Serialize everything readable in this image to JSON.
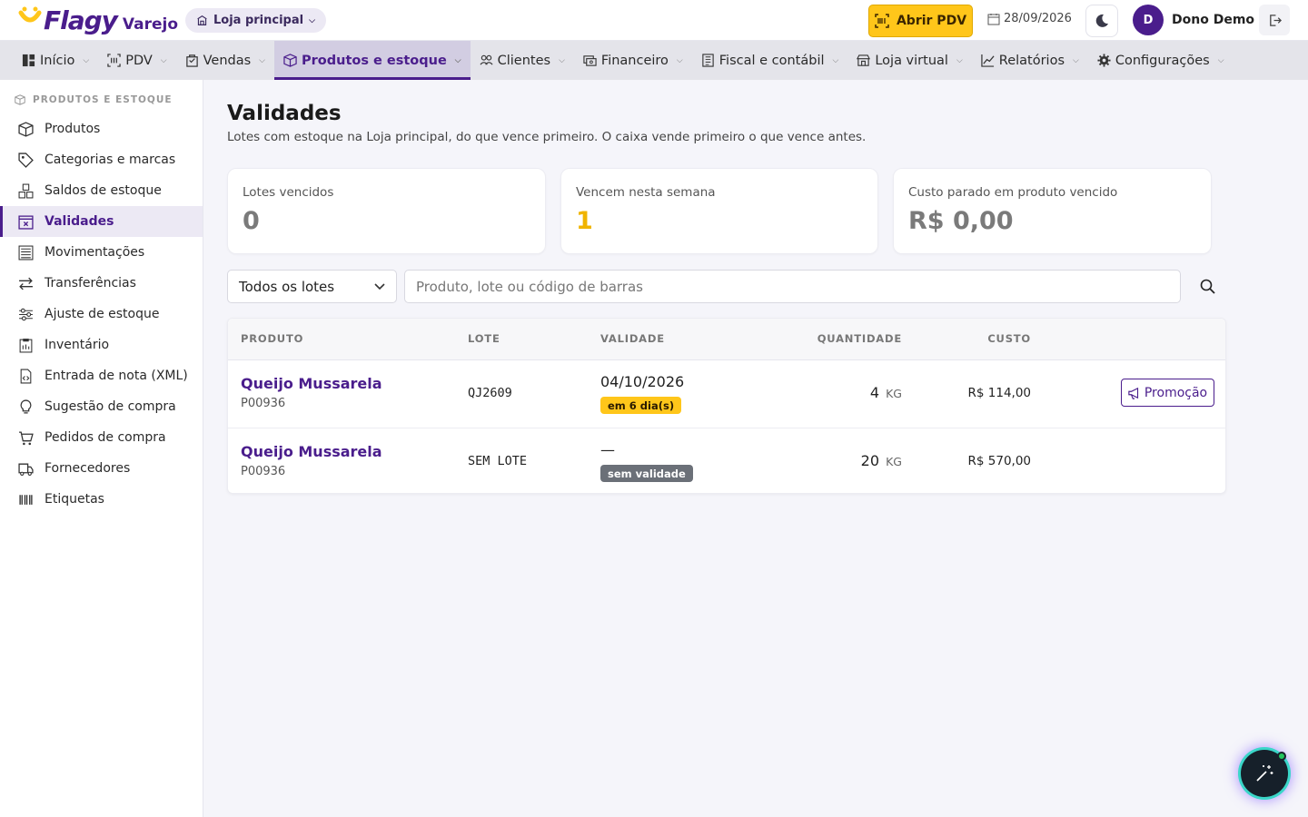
{
  "app": {
    "brand": "Flagy",
    "product": "Varejo",
    "store": "Loja principal",
    "open_pdv_label": "Abrir PDV",
    "date": "28/09/2026",
    "user_initial": "D",
    "user_name": "Dono Demo",
    "accent_color": "#4a1d8c",
    "highlight_color": "#ffc61a"
  },
  "nav": {
    "items": [
      {
        "label": "Início",
        "icon": "grid-icon"
      },
      {
        "label": "PDV",
        "icon": "barcode-icon"
      },
      {
        "label": "Vendas",
        "icon": "bag-icon"
      },
      {
        "label": "Produtos e estoque",
        "icon": "box-icon",
        "active": true
      },
      {
        "label": "Clientes",
        "icon": "users-icon"
      },
      {
        "label": "Financeiro",
        "icon": "cash-icon"
      },
      {
        "label": "Fiscal e contábil",
        "icon": "receipt-icon"
      },
      {
        "label": "Loja virtual",
        "icon": "shop-icon"
      },
      {
        "label": "Relatórios",
        "icon": "chart-icon"
      },
      {
        "label": "Configurações",
        "icon": "gear-icon"
      }
    ]
  },
  "sidebar": {
    "section": "PRODUTOS E ESTOQUE",
    "items": [
      {
        "label": "Produtos",
        "icon": "box-icon"
      },
      {
        "label": "Categorias e marcas",
        "icon": "tag-icon"
      },
      {
        "label": "Saldos de estoque",
        "icon": "boxes-icon"
      },
      {
        "label": "Validades",
        "icon": "calendar-x-icon",
        "active": true
      },
      {
        "label": "Movimentações",
        "icon": "list-icon"
      },
      {
        "label": "Transferências",
        "icon": "arrows-icon"
      },
      {
        "label": "Ajuste de estoque",
        "icon": "sliders-icon"
      },
      {
        "label": "Inventário",
        "icon": "clipboard-icon"
      },
      {
        "label": "Entrada de nota (XML)",
        "icon": "file-code-icon"
      },
      {
        "label": "Sugestão de compra",
        "icon": "bulb-icon"
      },
      {
        "label": "Pedidos de compra",
        "icon": "cart-icon"
      },
      {
        "label": "Fornecedores",
        "icon": "truck-icon"
      },
      {
        "label": "Etiquetas",
        "icon": "barcode-icon"
      }
    ]
  },
  "page": {
    "title": "Validades",
    "subtitle": "Lotes com estoque na Loja principal, do que vence primeiro. O caixa vende primeiro o que vence antes."
  },
  "kpis": [
    {
      "label": "Lotes vencidos",
      "value": "0"
    },
    {
      "label": "Vencem nesta semana",
      "value": "1"
    },
    {
      "label": "Custo parado em produto vencido",
      "value": "R$ 0,00"
    }
  ],
  "filters": {
    "select_value": "Todos os lotes",
    "search_placeholder": "Produto, lote ou código de barras"
  },
  "table": {
    "columns": [
      "PRODUTO",
      "LOTE",
      "VALIDADE",
      "QUANTIDADE",
      "CUSTO"
    ],
    "rows": [
      {
        "product": "Queijo Mussarela",
        "code": "P00936",
        "lot": "QJ2609",
        "expiry": "04/10/2026",
        "badge": "em 6 dia(s)",
        "qty": "4",
        "unit": "KG",
        "cost": "R$ 114,00",
        "action": "Promoção"
      },
      {
        "product": "Queijo Mussarela",
        "code": "P00936",
        "lot": "SEM LOTE",
        "expiry": "—",
        "badge": "sem validade",
        "qty": "20",
        "unit": "KG",
        "cost": "R$ 570,00"
      }
    ]
  }
}
